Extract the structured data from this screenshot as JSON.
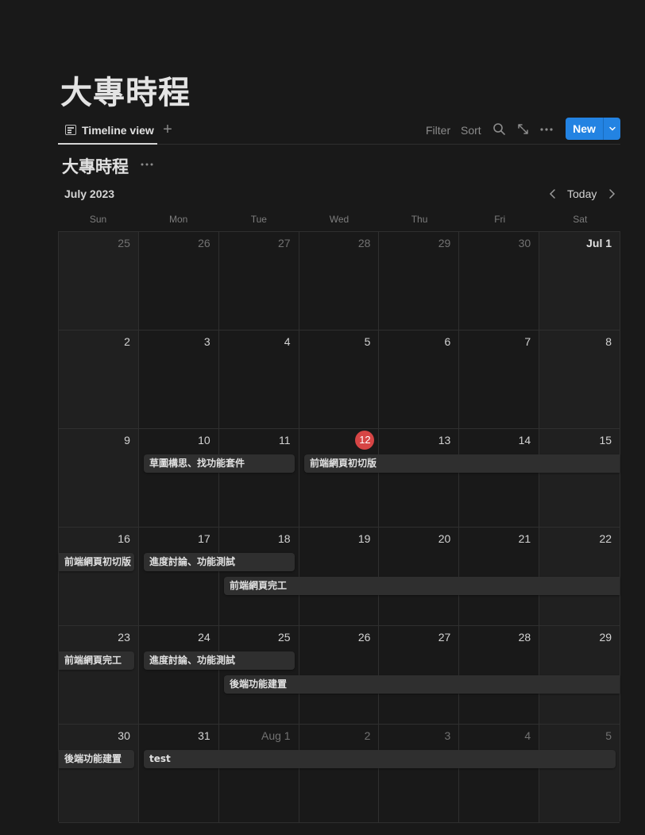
{
  "page": {
    "title": "大專時程"
  },
  "viewbar": {
    "active_tab": "Timeline view",
    "filter_label": "Filter",
    "sort_label": "Sort",
    "new_label": "New"
  },
  "database": {
    "title": "大專時程"
  },
  "calendar": {
    "month_label": "July 2023",
    "today_label": "Today",
    "weekdays": [
      "Sun",
      "Mon",
      "Tue",
      "Wed",
      "Thu",
      "Fri",
      "Sat"
    ],
    "weeks": [
      [
        "25",
        "26",
        "27",
        "28",
        "29",
        "30",
        "Jul 1"
      ],
      [
        "2",
        "3",
        "4",
        "5",
        "6",
        "7",
        "8"
      ],
      [
        "9",
        "10",
        "11",
        "12",
        "13",
        "14",
        "15"
      ],
      [
        "16",
        "17",
        "18",
        "19",
        "20",
        "21",
        "22"
      ],
      [
        "23",
        "24",
        "25",
        "26",
        "27",
        "28",
        "29"
      ],
      [
        "30",
        "31",
        "Aug 1",
        "2",
        "3",
        "4",
        "5"
      ]
    ],
    "today": "12",
    "events": [
      {
        "label": "草圖構思、找功能套件"
      },
      {
        "label": "前端網頁初切版"
      },
      {
        "label": "前端網頁初切版"
      },
      {
        "label": "進度討論、功能測試"
      },
      {
        "label": "前端網頁完工"
      },
      {
        "label": "前端網頁完工"
      },
      {
        "label": "進度討論、功能測試"
      },
      {
        "label": "後端功能建置"
      },
      {
        "label": "後端功能建置"
      },
      {
        "label": "test"
      }
    ]
  },
  "colors": {
    "accent": "#2383e2",
    "today": "#d64545",
    "background": "#191919"
  }
}
